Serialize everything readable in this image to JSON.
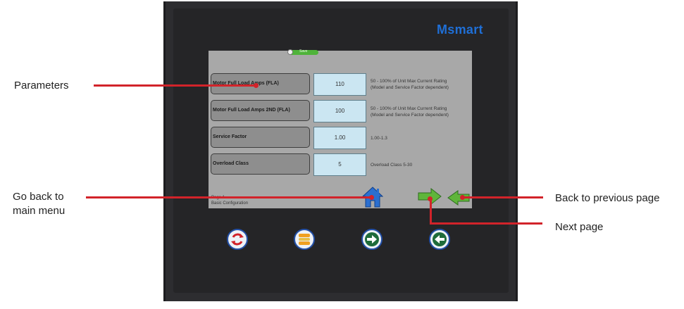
{
  "device": {
    "brand": "Msmart",
    "toggle_label": "Save"
  },
  "parameters": [
    {
      "label": "Motor Full Load Amps (FLA)",
      "value": "110",
      "desc": [
        "50 - 100% of Unit Max Current Rating",
        "(Model and Service Factor dependent)"
      ]
    },
    {
      "label": "Motor Full Load Amps 2ND (FLA)",
      "value": "100",
      "desc": [
        "50 - 100% of Unit Max Current Rating",
        "(Model and Service Factor dependent)"
      ]
    },
    {
      "label": "Service Factor",
      "value": "1.00",
      "desc": [
        "1.00-1.3"
      ]
    },
    {
      "label": "Overload Class",
      "value": "5",
      "desc": [
        "Overload Class 5-30"
      ]
    }
  ],
  "footer": {
    "page": "Page 1",
    "title": "Basic Configuration"
  },
  "callouts": {
    "parameters": "Parameters",
    "main_menu": [
      "Go back to",
      "main menu"
    ],
    "previous": "Back to previous page",
    "next": "Next page"
  },
  "colors": {
    "accent_red": "#d2232a",
    "brand_blue": "#1f6fd6",
    "nav_green": "#5fb53a"
  },
  "icons": {
    "home": "house-icon",
    "next": "arrow-right-icon",
    "prev": "arrow-left-icon",
    "hw1": "refresh-icon",
    "hw2": "menu-icon",
    "hw3": "arrow-right-icon",
    "hw4": "arrow-left-icon"
  }
}
